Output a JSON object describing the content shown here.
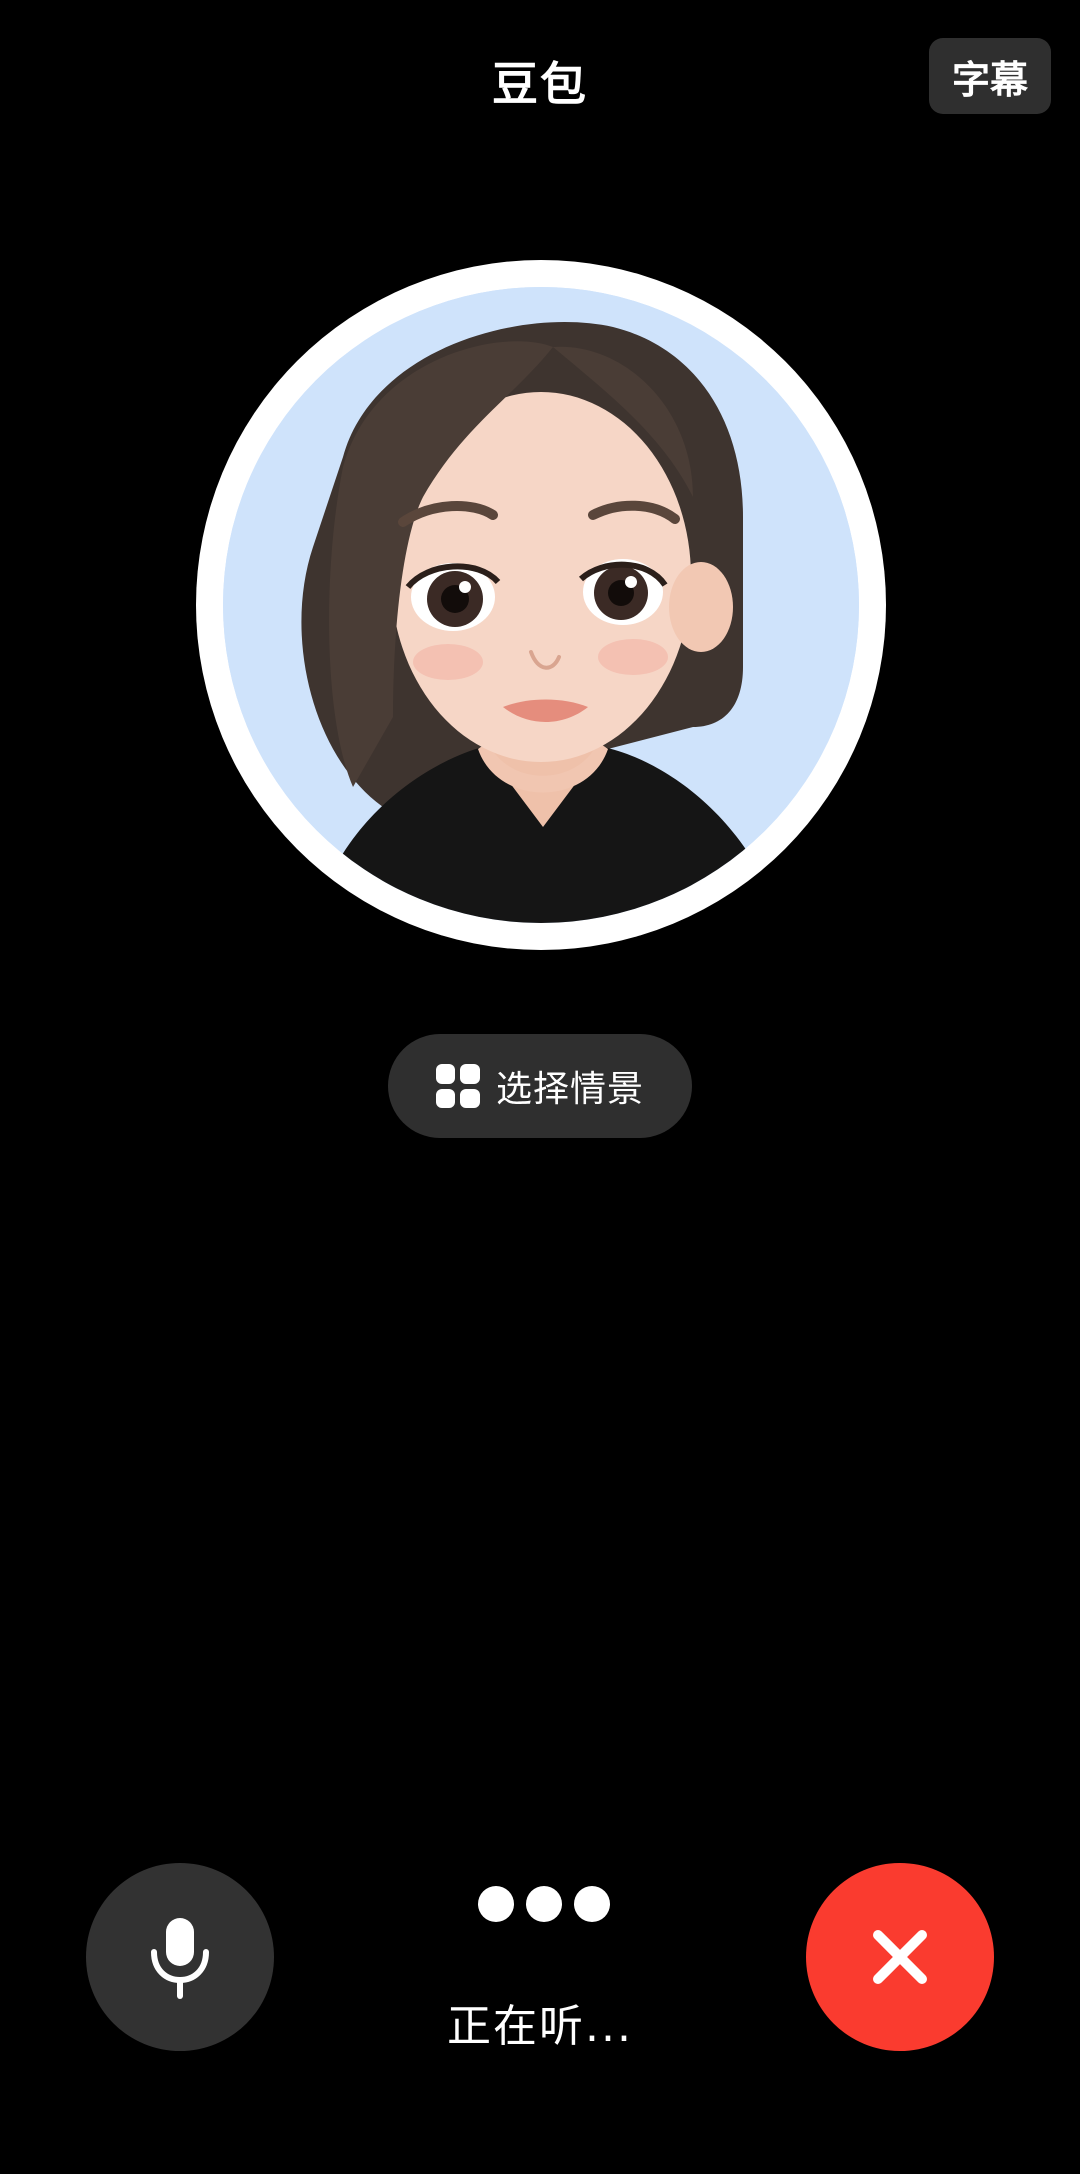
{
  "header": {
    "title": "豆包",
    "subtitle_button": "字幕"
  },
  "avatar": {
    "alt": "豆包 avatar"
  },
  "scene_button": {
    "label": "选择情景",
    "icon": "grid-icon"
  },
  "controls": {
    "mic_icon": "microphone-icon",
    "hangup_icon": "close-icon",
    "status": "正在听..."
  },
  "colors": {
    "background": "#000000",
    "hangup": "#fa3b2f",
    "button_bg": "#2f2f2f"
  }
}
